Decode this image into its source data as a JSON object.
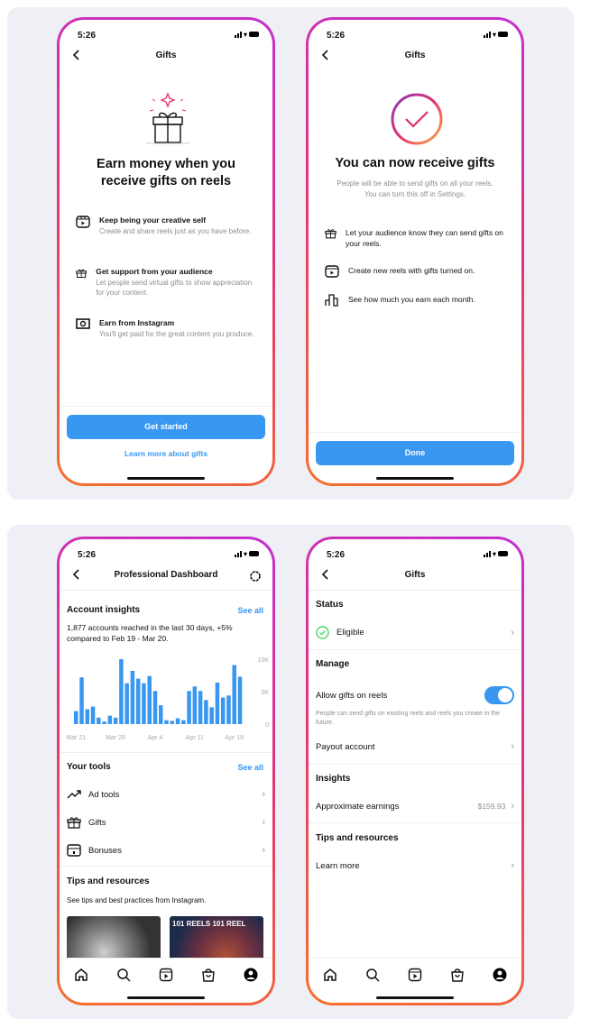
{
  "status_time": "5:26",
  "screen1": {
    "title": "Gifts",
    "headline": "Earn money when you receive gifts on reels",
    "items": [
      {
        "icon": "reels-icon",
        "title": "Keep being your creative self",
        "desc": "Create and share reels just as you have before."
      },
      {
        "icon": "gift-icon",
        "title": "Get support from your audience",
        "desc": "Let people send virtual gifts to show appreciation for your content."
      },
      {
        "icon": "money-icon",
        "title": "Earn from Instagram",
        "desc": "You'll get paid for the great content you produce."
      }
    ],
    "button": "Get started",
    "link": "Learn more about gifts"
  },
  "screen2": {
    "title": "Gifts",
    "headline": "You can now receive gifts",
    "sub": "People will be able to send gifts on all your reels. You can turn this off in Settings.",
    "items": [
      {
        "icon": "gift-icon",
        "text": "Let your audience know they can send gifts on your reels."
      },
      {
        "icon": "reels-icon",
        "text": "Create new reels with gifts turned on."
      },
      {
        "icon": "bar-chart-icon",
        "text": "See how much you earn each month."
      }
    ],
    "button": "Done"
  },
  "screen3": {
    "title": "Professional Dashboard",
    "insights_title": "Account insights",
    "see_all": "See all",
    "insights_text": "1,877 accounts reached in the last 30 days, +5% compared to Feb 19 - Mar 20.",
    "tools_title": "Your tools",
    "tools": [
      "Ad tools",
      "Gifts",
      "Bonuses"
    ],
    "tips_title": "Tips and resources",
    "tips_sub": "See tips and best practices from Instagram.",
    "thumb2_text": "101 REELS 101 REEL"
  },
  "chart_data": {
    "type": "bar",
    "x_tick_labels": [
      "Mar 21",
      "Mar 28",
      "Apr 4",
      "Apr 11",
      "Apr 19"
    ],
    "y_tick_labels": [
      "10K",
      "5K",
      "0"
    ],
    "ylim": [
      0,
      10000
    ],
    "values": [
      2000,
      7200,
      2300,
      2700,
      1000,
      400,
      1300,
      1000,
      10000,
      6300,
      8200,
      7000,
      6300,
      7400,
      5100,
      2900,
      600,
      500,
      900,
      600,
      5100,
      5800,
      5100,
      3700,
      2600,
      6400,
      4100,
      4400,
      9100,
      7300
    ],
    "color": "#3897f0"
  },
  "screen4": {
    "title": "Gifts",
    "status_title": "Status",
    "status": "Eligible",
    "manage_title": "Manage",
    "allow": "Allow gifts on reels",
    "allow_on": true,
    "allow_note": "People can send gifts on existing reels and reels you create in the future.",
    "payout": "Payout account",
    "insights_title": "Insights",
    "earnings_label": "Approximate earnings",
    "earnings_value": "$159.93",
    "tips_title": "Tips and resources",
    "learn_more": "Learn more"
  },
  "colors": {
    "accent": "#3897f0",
    "success": "#4cd964"
  }
}
